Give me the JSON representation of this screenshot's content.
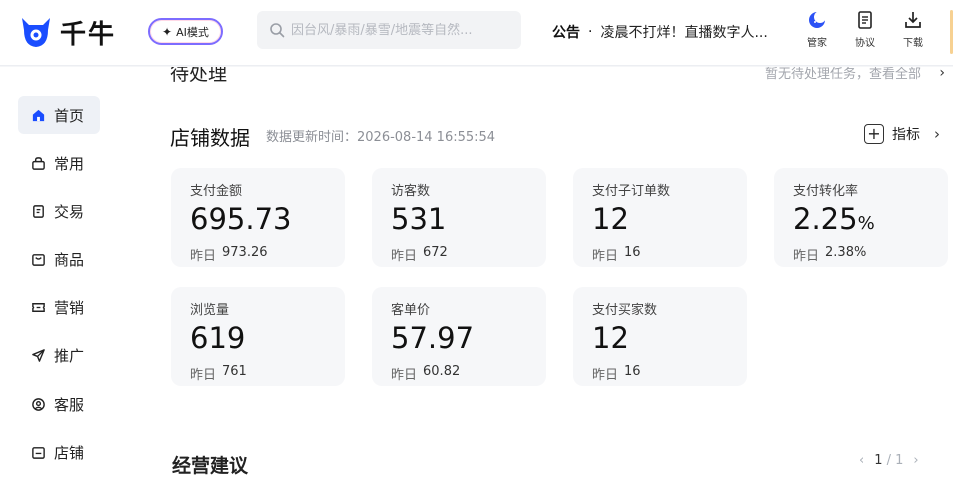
{
  "header": {
    "logo_text": "千牛",
    "ai_mode_label": "AI模式",
    "search_placeholder": "因台风/暴雨/暴雪/地震等自然...",
    "notice": {
      "label": "公告",
      "dot": "·",
      "text": "凌晨不打烊！直播数字人..."
    },
    "tools": [
      {
        "label": "管家",
        "icon": "moon-assistant-icon"
      },
      {
        "label": "协议",
        "icon": "document-icon"
      },
      {
        "label": "下载",
        "icon": "download-icon"
      }
    ]
  },
  "sidebar": {
    "items": [
      {
        "label": "首页",
        "icon": "home-icon",
        "active": true
      },
      {
        "label": "常用",
        "icon": "bag-icon",
        "active": false
      },
      {
        "label": "交易",
        "icon": "receipt-icon",
        "active": false
      },
      {
        "label": "商品",
        "icon": "product-icon",
        "active": false
      },
      {
        "label": "营销",
        "icon": "ticket-icon",
        "active": false
      },
      {
        "label": "推广",
        "icon": "send-icon",
        "active": false
      },
      {
        "label": "客服",
        "icon": "service-icon",
        "active": false
      },
      {
        "label": "店铺",
        "icon": "store-icon",
        "active": false
      }
    ]
  },
  "pending": {
    "title": "待处理",
    "link": "暂无待处理任务，查看全部"
  },
  "store_data": {
    "title": "店铺数据",
    "updated": "数据更新时间：2026-08-14 16:55:54",
    "metric_button": "指标",
    "prev_label": "昨日",
    "cards": [
      {
        "label": "支付金额",
        "value": "695.73",
        "unit": "",
        "prev": "973.26"
      },
      {
        "label": "访客数",
        "value": "531",
        "unit": "",
        "prev": "672"
      },
      {
        "label": "支付子订单数",
        "value": "12",
        "unit": "",
        "prev": "16"
      },
      {
        "label": "支付转化率",
        "value": "2.25",
        "unit": "%",
        "prev": "2.38%"
      },
      {
        "label": "浏览量",
        "value": "619",
        "unit": "",
        "prev": "761"
      },
      {
        "label": "客单价",
        "value": "57.97",
        "unit": "",
        "prev": "60.82"
      },
      {
        "label": "支付买家数",
        "value": "12",
        "unit": "",
        "prev": "16"
      }
    ]
  },
  "advice": {
    "title": "经营建议",
    "page_current": "1",
    "page_total": "/ 1"
  },
  "colors": {
    "brand": "#1a4dff",
    "active_bg": "#eef1f6",
    "card_bg": "#f6f7f9"
  }
}
